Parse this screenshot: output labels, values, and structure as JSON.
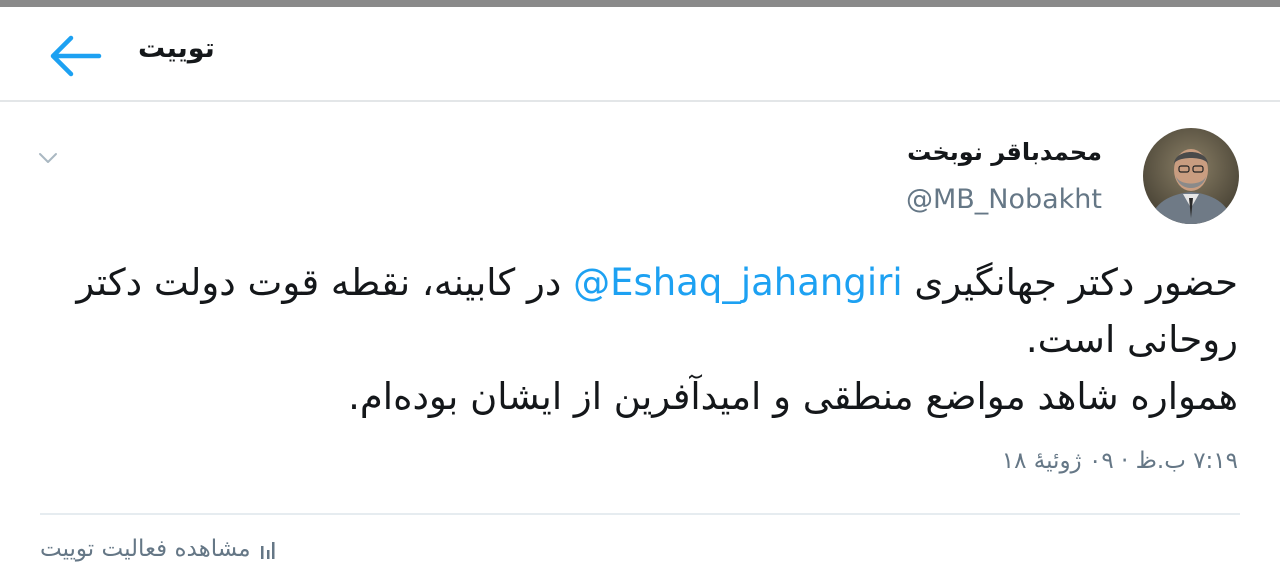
{
  "header": {
    "title": "توییت",
    "back_icon": "arrow-left-icon"
  },
  "tweet": {
    "author_name": "محمدباقر نوبخت",
    "handle": "@MB_Nobakht",
    "text_part1": "حضور دکتر جهانگیری ",
    "mention": "@Eshaq_jahangiri",
    "text_part2": " در کابینه، نقطه قوت دولت دکتر روحانی است.",
    "text_line3": "همواره شاهد مواضع منطقی و امیدآفرین از ایشان بوده‌ام.",
    "timestamp": "۷:۱۹ ب.ظ · ۰۹ ژوئیهٔ ۱۸",
    "activity_label": "مشاهده فعالیت توییت",
    "caret_icon": "chevron-down-icon",
    "activity_icon": "bar-chart-icon"
  },
  "colors": {
    "accent": "#1da1f2",
    "secondary_text": "#657786",
    "divider": "#e6ecf0"
  }
}
